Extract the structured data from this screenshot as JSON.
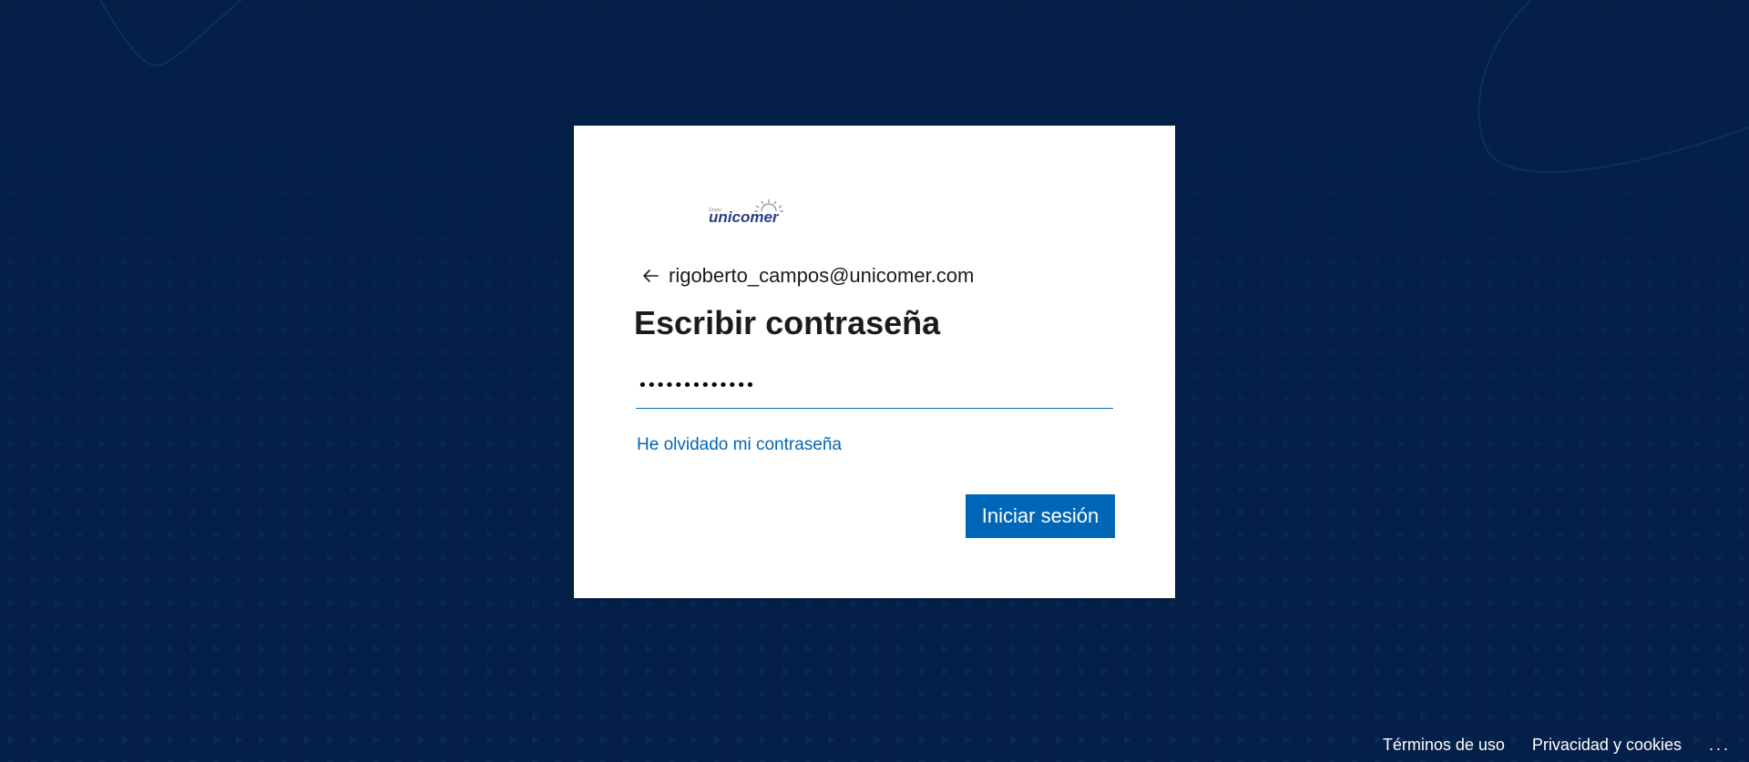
{
  "colors": {
    "background": "#052048",
    "card": "#ffffff",
    "accent": "#0067b8",
    "text": "#1b1b1b"
  },
  "logo": {
    "text": "unicomer",
    "small_text": "Grupo"
  },
  "identity": {
    "back_icon": "arrow-left-icon",
    "email": "rigoberto_campos@unicomer.com"
  },
  "page": {
    "title": "Escribir contraseña"
  },
  "password": {
    "masked_value": "•••••••••••••"
  },
  "links": {
    "forgot_password": "He olvidado mi contraseña"
  },
  "buttons": {
    "sign_in": "Iniciar sesión"
  },
  "footer": {
    "terms": "Términos de uso",
    "privacy": "Privacidad y cookies",
    "more": "..."
  }
}
